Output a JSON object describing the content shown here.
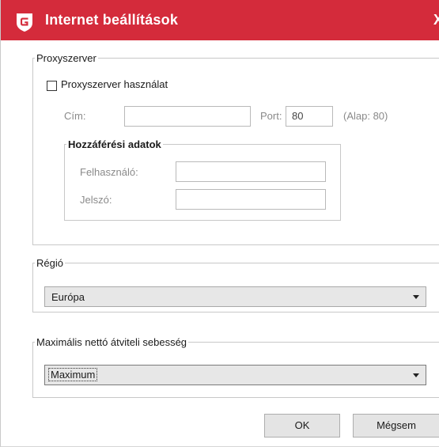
{
  "window": {
    "title": "Internet beállítások",
    "accent": "#d42b3b",
    "logo_icon": "gdata-shield-icon",
    "close_label": "X"
  },
  "proxy": {
    "legend": "Proxyszerver",
    "use_proxy_label": "Proxyszerver használat",
    "use_proxy_checked": false,
    "address_label": "Cím:",
    "address_value": "",
    "port_label": "Port:",
    "port_value": "80",
    "port_default": "(Alap: 80)",
    "access": {
      "legend": "Hozzáférési adatok",
      "user_label": "Felhasználó:",
      "user_value": "",
      "password_label": "Jelszó:",
      "password_value": ""
    }
  },
  "region": {
    "legend": "Régió",
    "selected": "Európa"
  },
  "speed": {
    "legend": "Maximális nettó átviteli sebesség",
    "selected": "Maximum"
  },
  "buttons": {
    "ok": "OK",
    "cancel": "Mégsem"
  }
}
